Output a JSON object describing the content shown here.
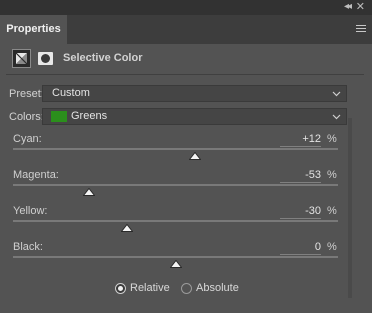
{
  "panel": {
    "tab_label": "Properties",
    "title": "Selective Color"
  },
  "icons": {
    "collapse": "collapse-arrows-icon",
    "close": "close-icon",
    "menu": "panel-menu-icon",
    "adjustment": "selective-color-adjustment-icon",
    "mask": "layer-mask-icon"
  },
  "preset": {
    "label": "Preset:",
    "value": "Custom"
  },
  "colors": {
    "label": "Colors:",
    "value": "Greens",
    "swatch_color": "#2b8f1c"
  },
  "sliders": [
    {
      "label": "Cyan:",
      "value": "+12",
      "unit": "%",
      "level_percent": 12
    },
    {
      "label": "Magenta:",
      "value": "-53",
      "unit": "%",
      "level_percent": -53
    },
    {
      "label": "Yellow:",
      "value": "-30",
      "unit": "%",
      "level_percent": -30
    },
    {
      "label": "Black:",
      "value": "0",
      "unit": "%",
      "level_percent": 0
    }
  ],
  "method": {
    "options": [
      "Relative",
      "Absolute"
    ],
    "selected": "Relative"
  }
}
